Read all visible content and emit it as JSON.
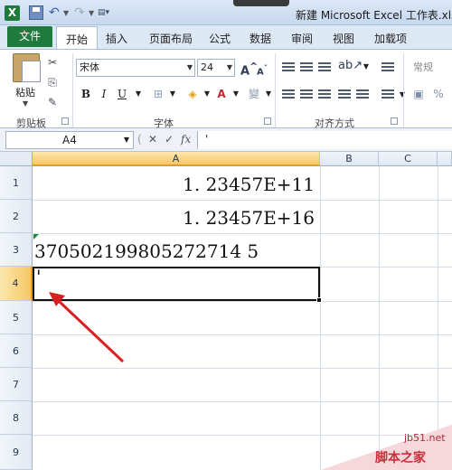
{
  "window": {
    "title": "新建 Microsoft Excel 工作表.xls [兼"
  },
  "ribbon_tabs": [
    "文件",
    "开始",
    "插入",
    "页面布局",
    "公式",
    "数据",
    "审阅",
    "视图",
    "加载项"
  ],
  "ribbon": {
    "clipboard": {
      "paste_label": "粘贴",
      "group_label": "剪贴板"
    },
    "font": {
      "name": "宋体",
      "size": "24",
      "bold": "B",
      "italic": "I",
      "underline": "U",
      "group_label": "字体"
    },
    "alignment": {
      "group_label": "对齐方式"
    },
    "number": {
      "format": "常规"
    }
  },
  "formula_bar": {
    "name_box": "A4",
    "fx": "fx",
    "content": "'"
  },
  "grid": {
    "columns": [
      "A",
      "B",
      "C"
    ],
    "selected_column": "A",
    "rows": [
      "1",
      "2",
      "3",
      "4",
      "5",
      "6",
      "7",
      "8",
      "9"
    ],
    "selected_row": "4",
    "cells": {
      "A1": "1. 23457E+11",
      "A2": "1. 23457E+16",
      "A3": "370502199805272714 5",
      "A4": "'"
    }
  },
  "watermark": {
    "domain": "jb51.net",
    "name": "脚本之家"
  },
  "colors": {
    "file_tab": "#1f7a3d",
    "selected_header": "#f6c767",
    "arrow": "#d92121"
  }
}
